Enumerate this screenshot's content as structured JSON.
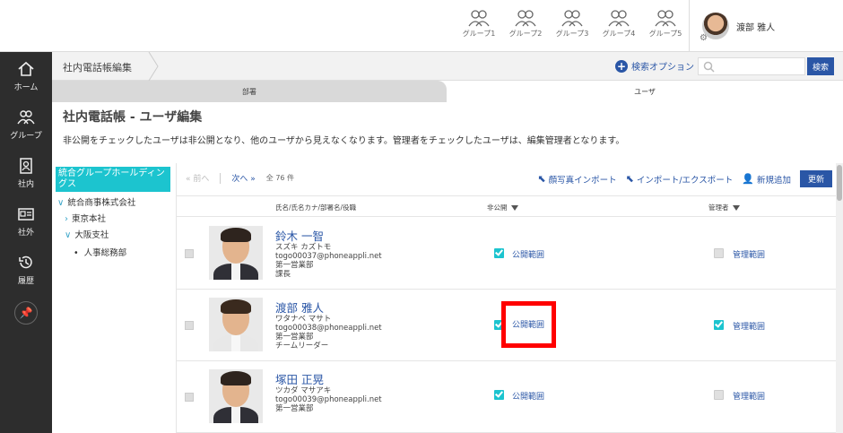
{
  "header": {
    "groups": [
      "グループ1",
      "グループ2",
      "グループ3",
      "グループ4",
      "グループ5"
    ],
    "user_name": "渡部 雅人"
  },
  "nav": {
    "items": [
      {
        "label": "ホーム",
        "icon": "home-icon"
      },
      {
        "label": "グループ",
        "icon": "group-icon"
      },
      {
        "label": "社内",
        "icon": "directory-book-icon"
      },
      {
        "label": "社外",
        "icon": "id-card-icon"
      },
      {
        "label": "履歴",
        "icon": "history-icon"
      }
    ]
  },
  "breadcrumb": {
    "label": "社内電話帳編集"
  },
  "search": {
    "option_label": "検索オプション",
    "placeholder": "",
    "button": "検索"
  },
  "tabs": [
    {
      "label": "部署"
    },
    {
      "label": "ユーザ"
    }
  ],
  "page": {
    "title": "社内電話帳 - ユーザ編集",
    "description": "非公開をチェックしたユーザは非公開となり、他のユーザから見えなくなります。管理者をチェックしたユーザは、編集管理者となります。"
  },
  "tree": {
    "root": "統合グループホールディングス",
    "nodes": [
      "統合商事株式会社",
      "東京本社",
      "大阪支社",
      "人事総務部"
    ]
  },
  "pager": {
    "prev": "前へ",
    "next": "次へ",
    "count": "全 76 件"
  },
  "actions": {
    "photo_import": "顔写真インポート",
    "import_export": "インポート/エクスポート",
    "add_new": "新規追加",
    "update": "更新"
  },
  "table": {
    "headers": {
      "name": "氏名/氏名カナ/部署名/役職",
      "private": "非公開",
      "admin": "管理者"
    },
    "rows": [
      {
        "name": "鈴木 一智",
        "kana": "スズキ カズトモ",
        "email": "togo00037@phoneappli.net",
        "dept": "第一営業部",
        "title": "課長",
        "private_checked": true,
        "private_label": "公開範囲",
        "admin_checked": false,
        "admin_label": "管理範囲"
      },
      {
        "name": "渡部 雅人",
        "kana": "ワタナベ マサト",
        "email": "togo00038@phoneappli.net",
        "dept": "第一営業部",
        "title": "チームリーダー",
        "private_checked": true,
        "private_label": "公開範囲",
        "admin_checked": true,
        "admin_label": "管理範囲"
      },
      {
        "name": "塚田 正晃",
        "kana": "ツカダ マサアキ",
        "email": "togo00039@phoneappli.net",
        "dept": "第一営業部",
        "title": "",
        "private_checked": true,
        "private_label": "公開範囲",
        "admin_checked": false,
        "admin_label": "管理範囲"
      }
    ]
  },
  "colors": {
    "accent": "#2a56a6",
    "teal": "#1cc4cf",
    "highlight": "#ff0000",
    "nav_bg": "#2d2d2d"
  }
}
